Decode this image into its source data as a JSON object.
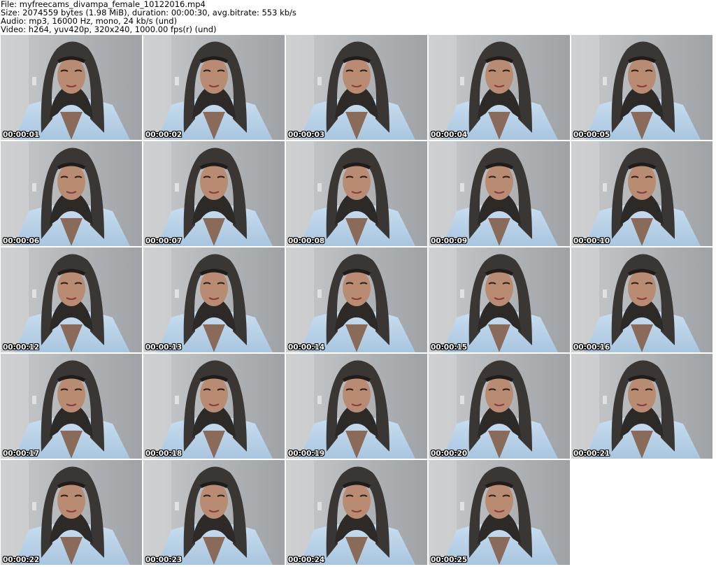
{
  "header": {
    "file_line": "File: myfreecams_divampa_female_10122016.mp4",
    "size_line": "Size: 2074559 bytes (1.98 MiB), duration: 00:00:30, avg.bitrate: 553 kb/s",
    "audio_line": "Audio: mp3, 16000 Hz, mono, 24 kb/s (und)",
    "video_line": "Video: h264, yuv420p, 320x240, 1000.00 fps(r) (und)"
  },
  "thumbnails": [
    {
      "timestamp": "00:00:01"
    },
    {
      "timestamp": "00:00:02"
    },
    {
      "timestamp": "00:00:03"
    },
    {
      "timestamp": "00:00:04"
    },
    {
      "timestamp": "00:00:05"
    },
    {
      "timestamp": "00:00:06"
    },
    {
      "timestamp": "00:00:07"
    },
    {
      "timestamp": "00:00:08"
    },
    {
      "timestamp": "00:00:09"
    },
    {
      "timestamp": "00:00:10"
    },
    {
      "timestamp": "00:00:12"
    },
    {
      "timestamp": "00:00:13"
    },
    {
      "timestamp": "00:00:14"
    },
    {
      "timestamp": "00:00:15"
    },
    {
      "timestamp": "00:00:16"
    },
    {
      "timestamp": "00:00:17"
    },
    {
      "timestamp": "00:00:18"
    },
    {
      "timestamp": "00:00:19"
    },
    {
      "timestamp": "00:00:20"
    },
    {
      "timestamp": "00:00:21"
    },
    {
      "timestamp": "00:00:22"
    },
    {
      "timestamp": "00:00:23"
    },
    {
      "timestamp": "00:00:24"
    },
    {
      "timestamp": "00:00:25"
    }
  ]
}
